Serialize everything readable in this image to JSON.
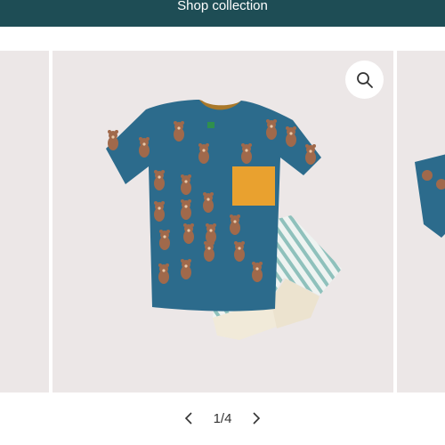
{
  "header": {
    "cta_label": "Shop collection",
    "background": "#1e4d55"
  },
  "gallery": {
    "slide_background": "#ece7e7",
    "main_image": "toddler bear print t-shirt with striped shorts",
    "zoom_icon": "search-icon"
  },
  "pagination": {
    "current": "1",
    "total": "4",
    "label": "1/4",
    "prev_icon": "chevron-left-icon",
    "next_icon": "chevron-right-icon"
  },
  "colors": {
    "shirt": "#2c6b8c",
    "pocket": "#e9a12f",
    "stripe": "#8fc1bc",
    "cuff": "#f1ead9",
    "bear": "#a0694b"
  }
}
